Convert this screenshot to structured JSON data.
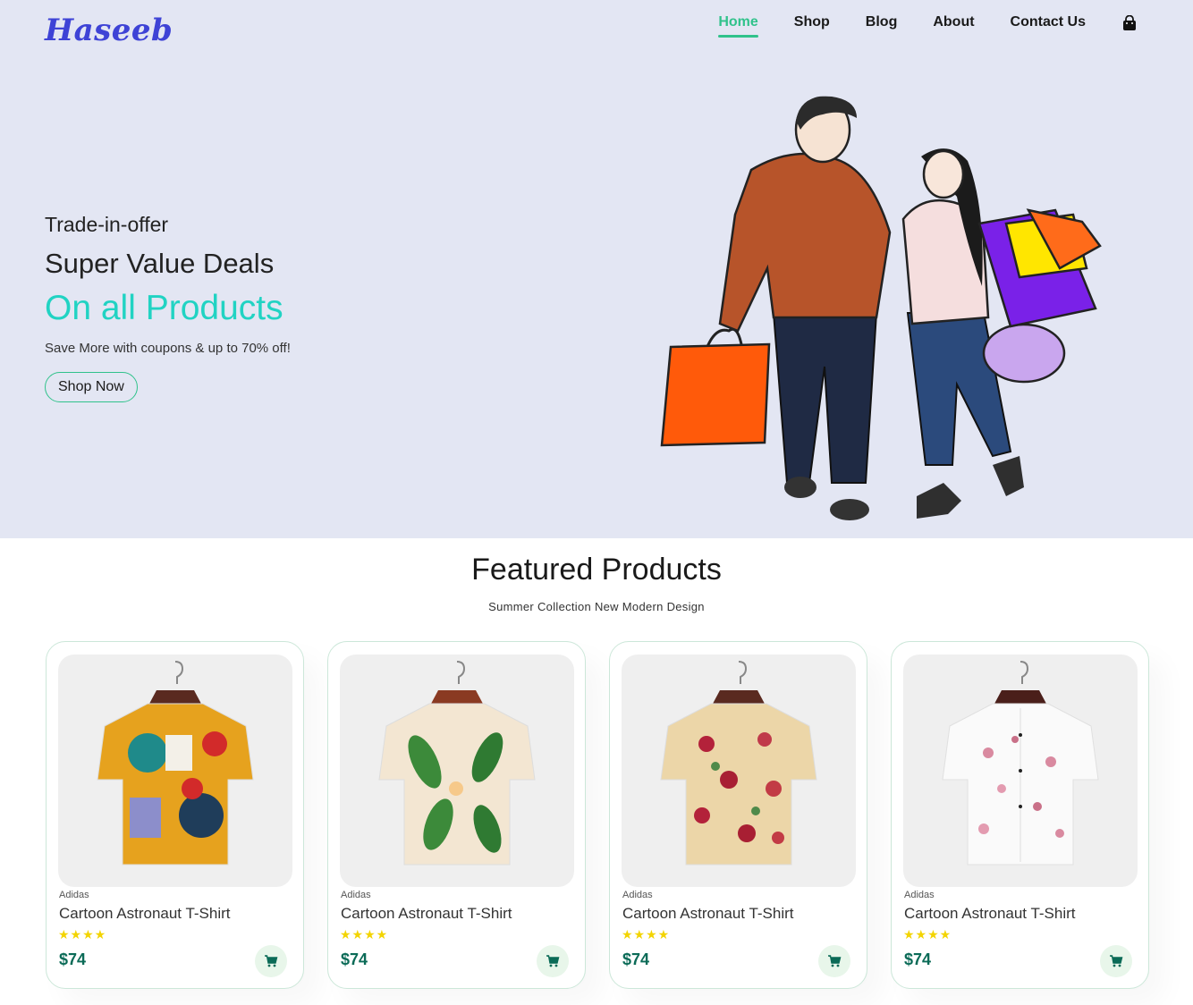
{
  "header": {
    "logo": "Haseeb",
    "nav": [
      {
        "label": "Home",
        "active": true
      },
      {
        "label": "Shop",
        "active": false
      },
      {
        "label": "Blog",
        "active": false
      },
      {
        "label": "About",
        "active": false
      },
      {
        "label": "Contact Us",
        "active": false
      }
    ],
    "cart_icon": "shopping-bag-icon"
  },
  "hero": {
    "line1": "Trade-in-offer",
    "line2": "Super Value Deals",
    "line3": "On all Products",
    "description": "Save More with coupons & up to 70% off!",
    "button_label": "Shop Now"
  },
  "featured": {
    "title": "Featured Products",
    "subtitle": "Summer Collection New Modern Design",
    "products": [
      {
        "brand": "Adidas",
        "name": "Cartoon Astronaut T-Shirt",
        "stars": "★★★★",
        "rating": 4,
        "price": "$74"
      },
      {
        "brand": "Adidas",
        "name": "Cartoon Astronaut T-Shirt",
        "stars": "★★★★",
        "rating": 4,
        "price": "$74"
      },
      {
        "brand": "Adidas",
        "name": "Cartoon Astronaut T-Shirt",
        "stars": "★★★★",
        "rating": 4,
        "price": "$74"
      },
      {
        "brand": "Adidas",
        "name": "Cartoon Astronaut T-Shirt",
        "stars": "★★★★",
        "rating": 4,
        "price": "$74"
      }
    ]
  },
  "colors": {
    "hero_bg": "#e3e6f3",
    "accent": "#30c28b",
    "highlight": "#21d3c3",
    "logo": "#3e43d6",
    "price": "#0b6b57",
    "star": "#f3d400"
  }
}
